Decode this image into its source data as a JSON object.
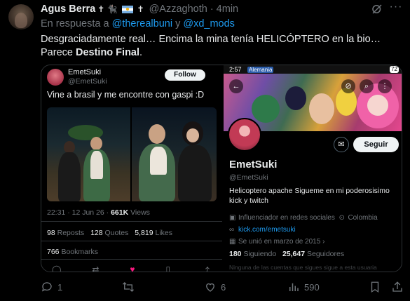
{
  "author": {
    "name": "Agus Berra",
    "badges": "✝ 🐈‍⬛",
    "badge_end": "✝",
    "handle": "@Azzaghoth",
    "dot": "·",
    "time": "4min"
  },
  "reply": {
    "prefix": "En respuesta a",
    "user1": "@therealbuni",
    "joiner": "y",
    "user2": "@xd_mods"
  },
  "tweet": {
    "line1": "Desgraciadamente real… Encima la mina tenía HELICÓPTERO en la bio…",
    "line2_pre": "Parece ",
    "line2_bold": "Destino Final",
    "line2_post": "."
  },
  "left_shot": {
    "name": "EmetSuki",
    "handle": "@EmetSuki",
    "follow": "Follow",
    "text": "Vine a brasil y me encontre con gaspi :D",
    "stats_time": "22:31 · 12 Jun 26 · ",
    "stats_views": "661K",
    "stats_views_label": " Views",
    "reposts": "98",
    "reposts_label": "Reposts",
    "quotes": "128",
    "quotes_label": "Quotes",
    "likes": "5,819",
    "likes_label": "Likes",
    "bookmarks": "766",
    "bookmarks_label": "Bookmarks"
  },
  "right_shot": {
    "time": "2:57",
    "carrier": "Alemania",
    "battery": "72",
    "name": "EmetSuki",
    "handle": "@EmetSuki",
    "follow": "Seguir",
    "bio": "Helicoptero apache Sigueme en mi poderosisimo kick y twitch",
    "category": "Influenciador en redes sociales",
    "location": "Colombia",
    "link": "kick.com/emetsuki",
    "joined": "Se unió en marzo de 2015",
    "following_count": "180",
    "following_label": "Siguiendo",
    "followers_count": "25,647",
    "followers_label": "Seguidores",
    "faded": "Ninguna de las cuentas que sigues sigue a esta usuaria"
  },
  "actions": {
    "replies": "1",
    "reposts": "",
    "likes": "6",
    "views": "590"
  },
  "colors": {
    "accent": "#1d9bf0",
    "muted": "#71767b",
    "like": "#f91880"
  }
}
